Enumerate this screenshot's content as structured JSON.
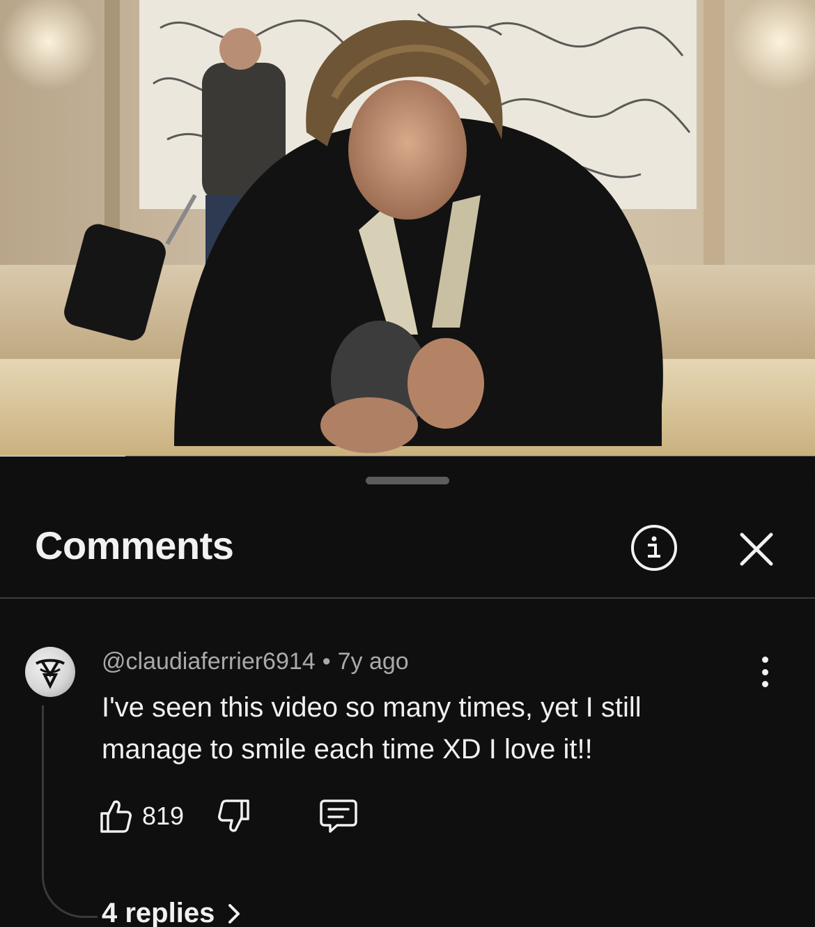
{
  "video": {
    "progress_fraction": 0.154
  },
  "sheet": {
    "title": "Comments"
  },
  "comment": {
    "author": "@claudiaferrier6914",
    "separator": "•",
    "age": "7y ago",
    "text": "I've seen this video so many times, yet I still manage to smile each time XD I love it!!",
    "likes": "819",
    "replies_label": "4 replies"
  },
  "colors": {
    "background": "#0f0f0f",
    "text_primary": "#f1f1f1",
    "text_secondary": "#aaaaaa",
    "divider": "#3d3d3d"
  },
  "icons": {
    "info": "info-icon",
    "close": "close-icon",
    "more": "more-vertical-icon",
    "like": "thumbs-up-icon",
    "dislike": "thumbs-down-icon",
    "reply": "reply-comment-icon",
    "chevron": "chevron-right-icon"
  }
}
